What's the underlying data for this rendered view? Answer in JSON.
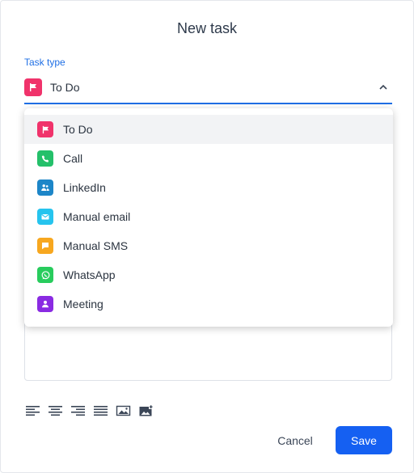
{
  "dialog": {
    "title": "New task",
    "task_type_label": "Task type",
    "selected_value": "To Do",
    "selected_icon": "flag-icon",
    "selected_color": "#f0336b"
  },
  "options": [
    {
      "label": "To Do",
      "icon": "flag-icon",
      "color": "#f0336b",
      "selected": true
    },
    {
      "label": "Call",
      "icon": "phone-icon",
      "color": "#24c06a",
      "selected": false
    },
    {
      "label": "LinkedIn",
      "icon": "people-icon",
      "color": "#1d86c8",
      "selected": false
    },
    {
      "label": "Manual email",
      "icon": "mail-icon",
      "color": "#26c4ee",
      "selected": false
    },
    {
      "label": "Manual SMS",
      "icon": "chat-icon",
      "color": "#f7a71f",
      "selected": false
    },
    {
      "label": "WhatsApp",
      "icon": "whatsapp-icon",
      "color": "#28cc5d",
      "selected": false
    },
    {
      "label": "Meeting",
      "icon": "person-icon",
      "color": "#8a2be2",
      "selected": false
    }
  ],
  "toolbar": {
    "tools": [
      "align-left-icon",
      "align-center-icon",
      "align-right-icon",
      "align-justify-icon",
      "image-icon",
      "image-upload-icon"
    ]
  },
  "footer": {
    "cancel_label": "Cancel",
    "save_label": "Save",
    "save_color": "#1560f2"
  }
}
